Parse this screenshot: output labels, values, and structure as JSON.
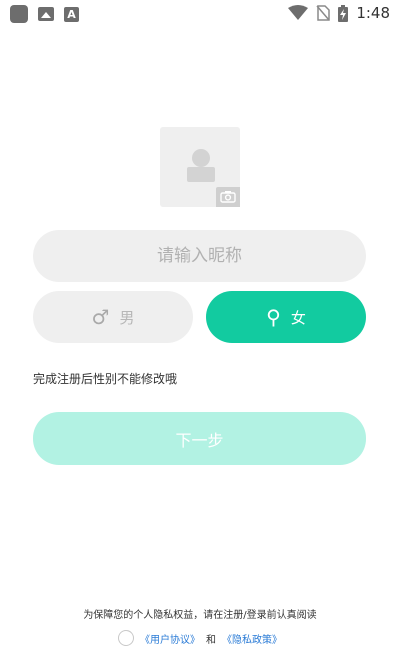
{
  "status_bar": {
    "time": "1:48"
  },
  "nickname": {
    "placeholder": "请输入昵称"
  },
  "gender": {
    "male": {
      "label": "男",
      "glyph": "♂",
      "selected": false
    },
    "female": {
      "label": "女",
      "glyph": "⚲",
      "selected": true
    }
  },
  "tip": "完成注册后性别不能修改哦",
  "next_button": "下一步",
  "notice": "为保障您的个人隐私权益，请在注册/登录前认真阅读",
  "agreement": {
    "user_agreement": "《用户协议》",
    "and": "和",
    "privacy_policy": "《隐私政策》"
  },
  "colors": {
    "accent": "#12cba0",
    "next_button_bg": "#b2f2e3",
    "link": "#2a7bd6"
  }
}
